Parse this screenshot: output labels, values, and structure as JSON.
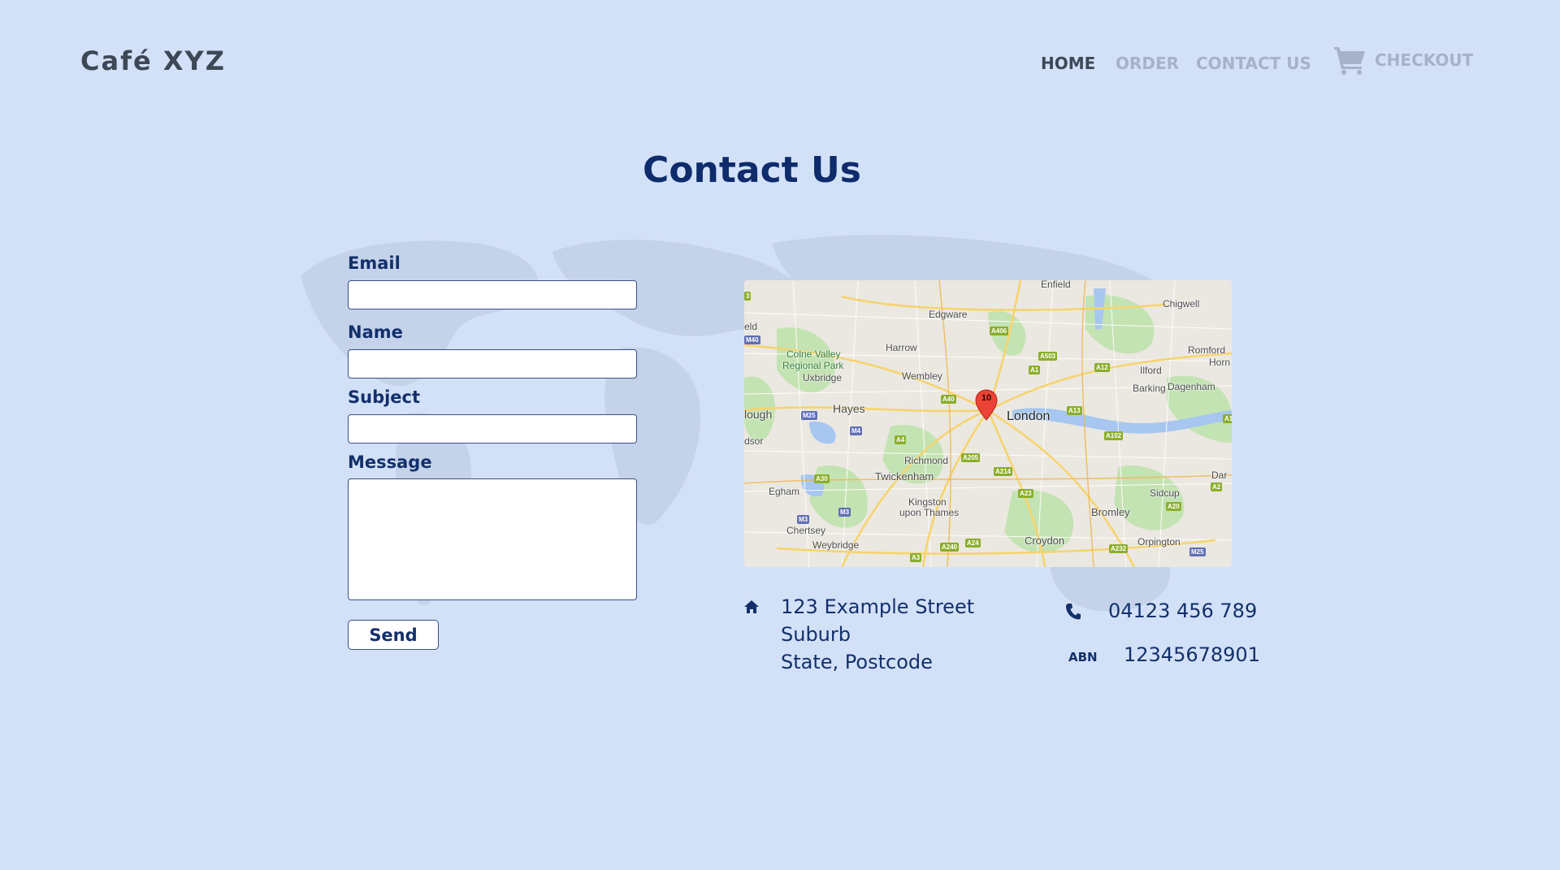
{
  "header": {
    "brand": "Café XYZ",
    "nav": {
      "home": "HOME",
      "order": "ORDER",
      "contact": "CONTACT US",
      "checkout": "CHECKOUT"
    }
  },
  "page": {
    "title": "Contact Us"
  },
  "form": {
    "email_label": "Email",
    "email_value": "",
    "name_label": "Name",
    "name_value": "",
    "subject_label": "Subject",
    "subject_value": "",
    "message_label": "Message",
    "message_value": "",
    "send_label": "Send"
  },
  "map": {
    "pin_label": "10",
    "places": {
      "enfield": "Enfield",
      "chigwell": "Chigwell",
      "edgware": "Edgware",
      "harrow": "Harrow",
      "romford": "Romford",
      "horn": "Horn",
      "colne_valley": "Colne Valley",
      "regional_park": "Regional Park",
      "uxbridge": "Uxbridge",
      "wembley": "Wembley",
      "ilford": "Ilford",
      "barking": "Barking",
      "dagenham": "Dagenham",
      "slough": "lough",
      "hayes": "Hayes",
      "london": "London",
      "windsor": "dsor",
      "richmond": "Richmond",
      "twickenham": "Twickenham",
      "dartford": "Dar",
      "egham": "Egham",
      "sidcup": "Sidcup",
      "kingston_1": "Kingston",
      "kingston_2": "upon Thames",
      "bromley": "Bromley",
      "chertsey": "Chertsey",
      "weybridge": "Weybridge",
      "croydon": "Croydon",
      "orpington": "Orpington",
      "edge_ld": "eld"
    },
    "roads": {
      "a406": "A406",
      "a503": "A503",
      "a1": "A1",
      "a12": "A12",
      "m40": "M40",
      "a40": "A40",
      "a13": "A13",
      "m25_w": "M25",
      "m4": "M4",
      "a4": "A4",
      "a102": "A102",
      "a205": "A205",
      "a214": "A214",
      "a30": "A30",
      "a23": "A23",
      "a2": "A2",
      "a20": "A20",
      "m3": "M3",
      "m3b": "M3",
      "a240": "A240",
      "a24": "A24",
      "a3": "A3",
      "a232": "A232",
      "m25_e": "M25",
      "a1_e": "A1",
      "a_w": "3"
    }
  },
  "contact": {
    "address_line1": "123 Example Street",
    "address_line2": "Suburb",
    "address_line3": "State, Postcode",
    "phone": "04123 456 789",
    "abn_label": "ABN",
    "abn_value": "12345678901"
  }
}
